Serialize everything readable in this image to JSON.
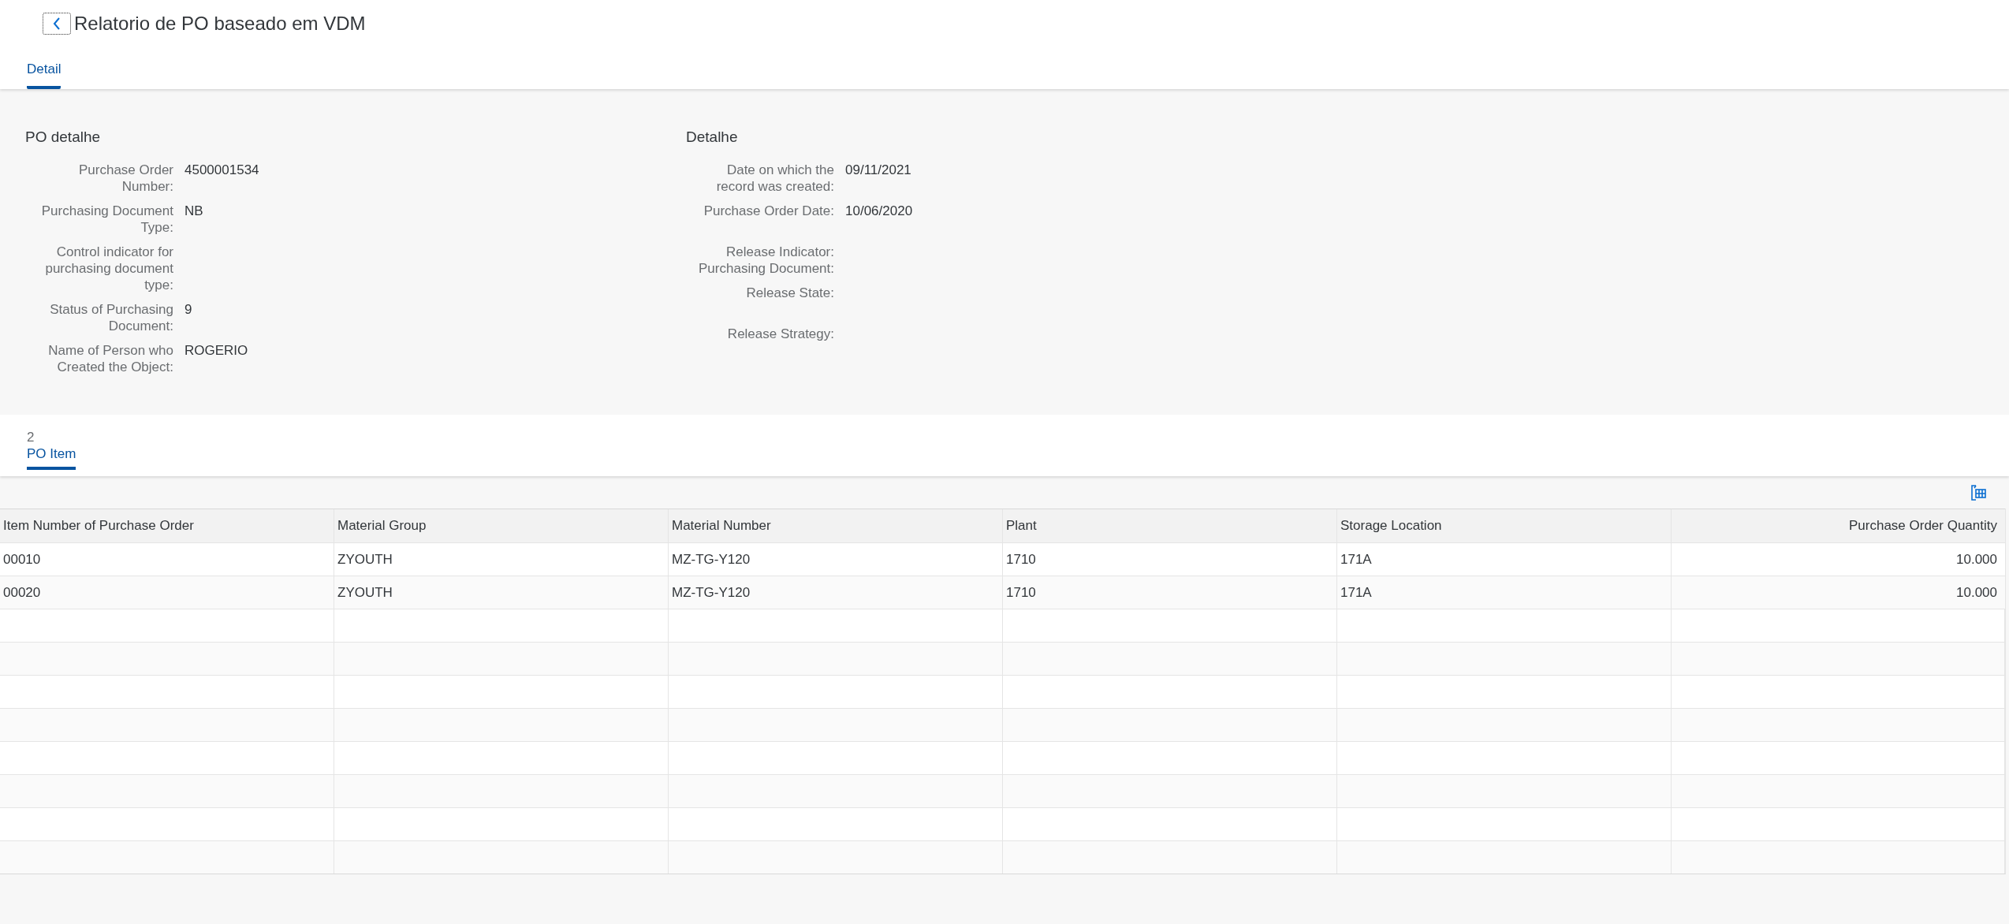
{
  "header": {
    "title": "Relatorio de PO baseado em VDM"
  },
  "tabs": [
    {
      "label": "Detail",
      "selected": true
    }
  ],
  "form_groups": [
    {
      "title": "PO detalhe",
      "fields": [
        {
          "label": "Purchase Order Number:",
          "value": "4500001534"
        },
        {
          "label": "Purchasing Document Type:",
          "value": "NB"
        },
        {
          "label": "Control indicator for purchasing document type:"
        },
        {
          "label": "Status of Purchasing Document:",
          "value": "9"
        },
        {
          "label": "Name of Person who Created the Object:",
          "value": "ROGERIO"
        }
      ]
    },
    {
      "title": "Detalhe",
      "fields": [
        {
          "label": "Date on which the record was created:",
          "value": "09/11/2021"
        },
        {
          "label": "Purchase Order Date:",
          "value": "10/06/2020"
        },
        {
          "label": "Release Indicator: Purchasing Document:"
        },
        {
          "label": "Release State:"
        },
        {
          "label": "Release Strategy:"
        }
      ]
    }
  ],
  "item_tabs": [
    {
      "count": "2",
      "label": "PO Item",
      "selected": true
    }
  ],
  "table": {
    "columns": [
      {
        "label": "Item Number of Purchase Order",
        "kind": "text"
      },
      {
        "label": "Material Group",
        "kind": "text"
      },
      {
        "label": "Material Number",
        "kind": "text"
      },
      {
        "label": "Plant",
        "kind": "text"
      },
      {
        "label": "Storage Location",
        "kind": "text"
      },
      {
        "label": "Purchase Order Quantity",
        "kind": "number"
      }
    ],
    "rows": [
      [
        "00010",
        "ZYOUTH",
        "MZ-TG-Y120",
        "1710",
        "171A",
        "10.000"
      ],
      [
        "00020",
        "ZYOUTH",
        "MZ-TG-Y120",
        "1710",
        "171A",
        "10.000"
      ]
    ]
  }
}
